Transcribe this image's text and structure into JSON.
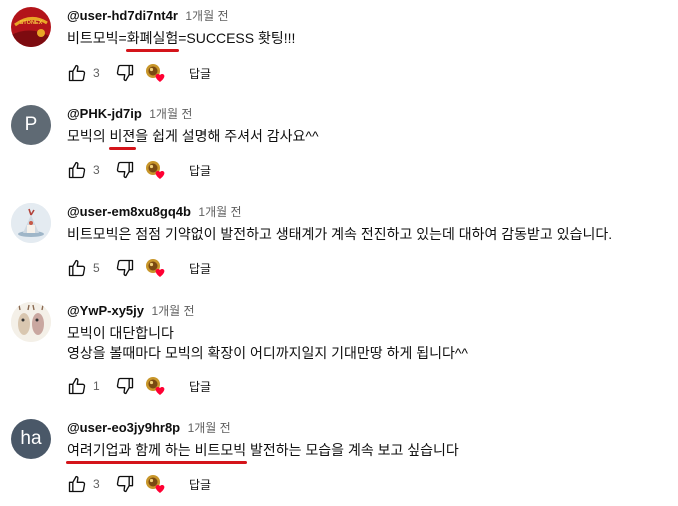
{
  "comments": [
    {
      "author": "@user-hd7di7nt4r",
      "time": "1개월 전",
      "avatar_logo_text": "STONEX",
      "lines": [
        [
          {
            "t": "비트모빅="
          },
          {
            "t": "화폐실험",
            "hl": true
          },
          {
            "t": "=SUCCESS 홧팅!!!"
          }
        ]
      ],
      "likes": "3",
      "reply_label": "답글"
    },
    {
      "author": "@PHK-jd7ip",
      "time": "1개월 전",
      "avatar_letter": "P",
      "lines": [
        [
          {
            "t": "모빅의 "
          },
          {
            "t": "비젼",
            "hl": true
          },
          {
            "t": "을 쉽게 설명해 주셔서 감사요^^"
          }
        ]
      ],
      "likes": "3",
      "reply_label": "답글"
    },
    {
      "author": "@user-em8xu8gq4b",
      "time": "1개월 전",
      "lines": [
        [
          {
            "t": "비트모빅은 점점 기약없이 발전하고 생태계가 계속 전진하고 있는데 대하여 감동받고 있습니다."
          }
        ]
      ],
      "likes": "5",
      "reply_label": "답글"
    },
    {
      "author": "@YwP-xy5jy",
      "time": "1개월 전",
      "lines": [
        [
          {
            "t": "모빅이 대단합니다"
          }
        ],
        [
          {
            "t": "영상을 볼때마다 모빅의 확장이 어디까지일지 기대만땅 하게 됩니다^^"
          }
        ]
      ],
      "likes": "1",
      "reply_label": "답글"
    },
    {
      "author": "@user-eo3jy9hr8p",
      "time": "1개월 전",
      "avatar_letter": "ha",
      "lines": [
        [
          {
            "t": "여려기업과 함께 하는 비트모빅",
            "hl": true
          },
          {
            "t": " 발전하는 모습을 계속 보고 싶습니다"
          }
        ]
      ],
      "likes": "3",
      "reply_label": "답글"
    }
  ],
  "colors": {
    "avatar_p": "#5f6a74",
    "avatar_ha": "#4a5868",
    "highlight": "#d4141a",
    "heart": "#ff0033"
  }
}
